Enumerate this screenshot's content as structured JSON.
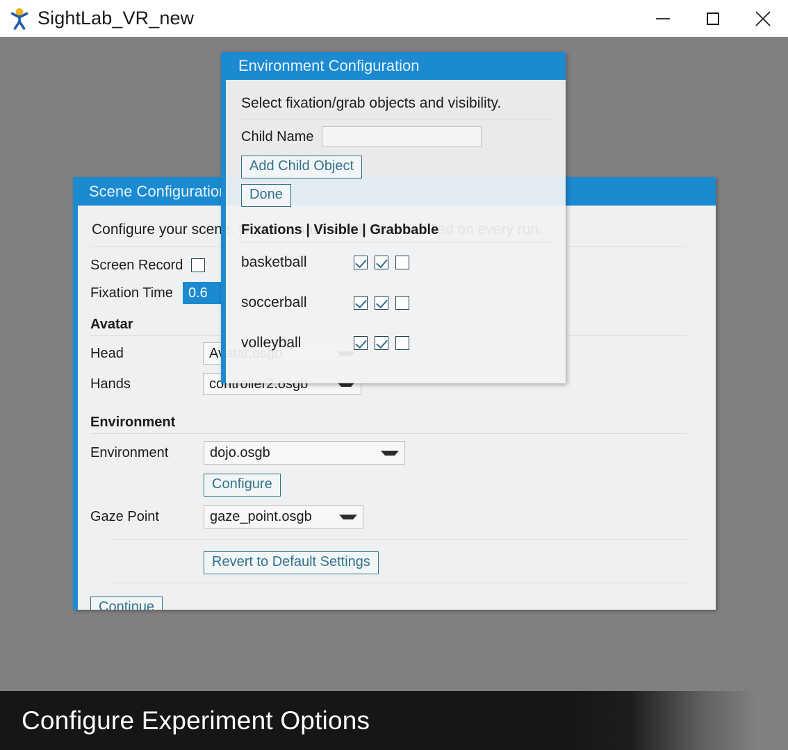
{
  "window": {
    "title": "SightLab_VR_new",
    "icon": "sightlab-logo-icon",
    "controls": {
      "minimize": "minimize-icon",
      "maximize": "maximize-icon",
      "close": "close-icon"
    }
  },
  "scene_dialog": {
    "title": "Scene Configuration",
    "description": "Configure your scene. Options marked will be auto-filled on every run.",
    "screen_record": {
      "label": "Screen Record",
      "checked": false
    },
    "fixation_time": {
      "label": "Fixation Time",
      "value": "0.6"
    },
    "avatar_section": {
      "heading": "Avatar",
      "head": {
        "label": "Head",
        "value": "Avatar.osgb"
      },
      "hands": {
        "label": "Hands",
        "value": "controller2.osgb"
      }
    },
    "environment_section": {
      "heading": "Environment",
      "environment": {
        "label": "Environment",
        "value": "dojo.osgb"
      },
      "configure_button": "Configure",
      "gaze_point": {
        "label": "Gaze Point",
        "value": "gaze_point.osgb"
      }
    },
    "revert_button": "Revert to Default Settings",
    "continue_button": "Continue"
  },
  "env_dialog": {
    "title": "Environment Configuration",
    "description": "Select fixation/grab objects and visibility.",
    "child_name": {
      "label": "Child Name",
      "value": "",
      "placeholder": ""
    },
    "add_child_button": "Add Child Object",
    "done_button": "Done",
    "table_heading": "Fixations | Visible | Grabbable",
    "rows": [
      {
        "name": "basketball",
        "fixation": true,
        "visible": true,
        "grabbable": false
      },
      {
        "name": "soccerball",
        "fixation": true,
        "visible": true,
        "grabbable": false
      },
      {
        "name": "volleyball",
        "fixation": true,
        "visible": true,
        "grabbable": false
      }
    ]
  },
  "caption": {
    "text": "Configure Experiment Options"
  },
  "colors": {
    "accent_blue": "#1b8ad1",
    "desktop_gray": "#808080",
    "panel_gray": "#eff0f1",
    "button_teal": "#33728c",
    "caption_bar": "#161616"
  }
}
